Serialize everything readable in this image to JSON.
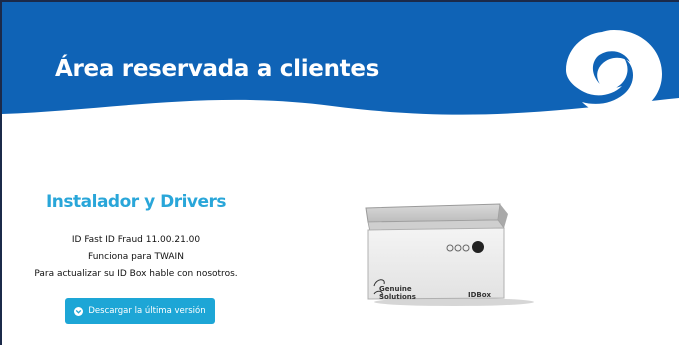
{
  "header": {
    "title": "Área reservada a clientes",
    "background_color": "#0f63b6"
  },
  "logo": {
    "icon": "company-swirl-logo"
  },
  "product": {
    "title": "Instalador y Drivers",
    "lines": [
      "ID Fast ID Fraud 11.00.21.00",
      "Funciona para TWAIN",
      "Para actualizar su ID Box hable con nosotros."
    ],
    "download_button": {
      "label": "Descargar la última versión",
      "icon": "chevron-down-circle-icon"
    }
  },
  "device_image": {
    "brand_line_1": "Genuine",
    "brand_line_2": "Solutions",
    "model": "IDBox"
  },
  "colors": {
    "accent": "#29a6d9",
    "button": "#1da6d6",
    "header": "#0f63b6"
  }
}
